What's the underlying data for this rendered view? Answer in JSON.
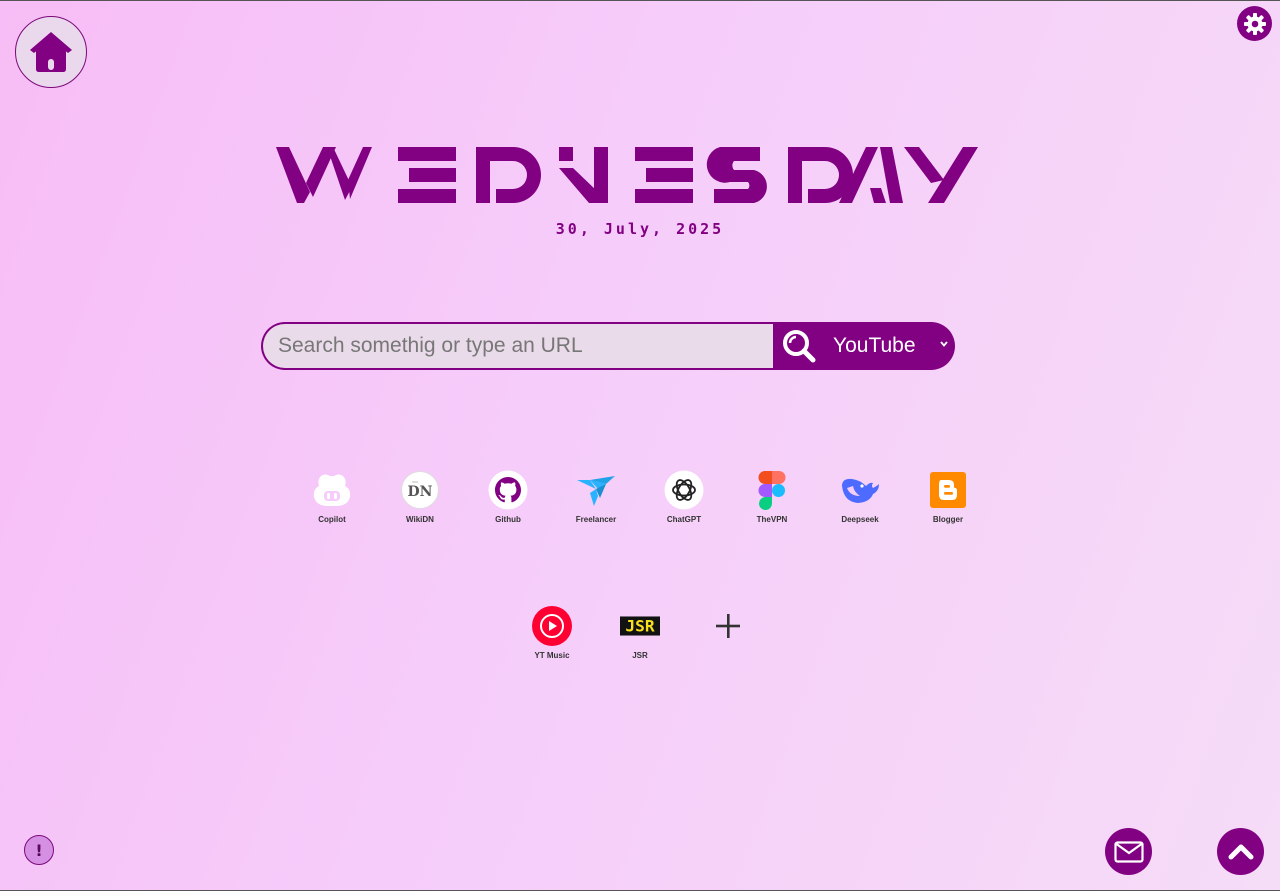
{
  "header": {
    "day": "WEDNESDAY",
    "date": "30, July, 2025"
  },
  "search": {
    "placeholder": "Search somethig or type an URL",
    "engine": "YouTube"
  },
  "shortcuts_row1": [
    {
      "label": "Copilot",
      "icon": "copilot-icon"
    },
    {
      "label": "WikiDN",
      "icon": "wikidn-icon"
    },
    {
      "label": "Github",
      "icon": "github-icon"
    },
    {
      "label": "Freelancer",
      "icon": "freelancer-icon"
    },
    {
      "label": "ChatGPT",
      "icon": "chatgpt-icon"
    },
    {
      "label": "TheVPN",
      "icon": "figma-icon"
    },
    {
      "label": "Deepseek",
      "icon": "deepseek-icon"
    },
    {
      "label": "Blogger",
      "icon": "blogger-icon"
    }
  ],
  "shortcuts_row2": [
    {
      "label": "YT Music",
      "icon": "yt-music-icon"
    },
    {
      "label": "JSR",
      "icon": "jsr-icon"
    },
    {
      "label": "",
      "icon": "add-icon"
    }
  ],
  "jsr_logo_text": "JSR",
  "wikidn_logo_text": "DN",
  "info_glyph": "!",
  "colors": {
    "accent": "#820182",
    "input_bg": "#e9dbe9",
    "home_bg": "#ead8ec"
  }
}
